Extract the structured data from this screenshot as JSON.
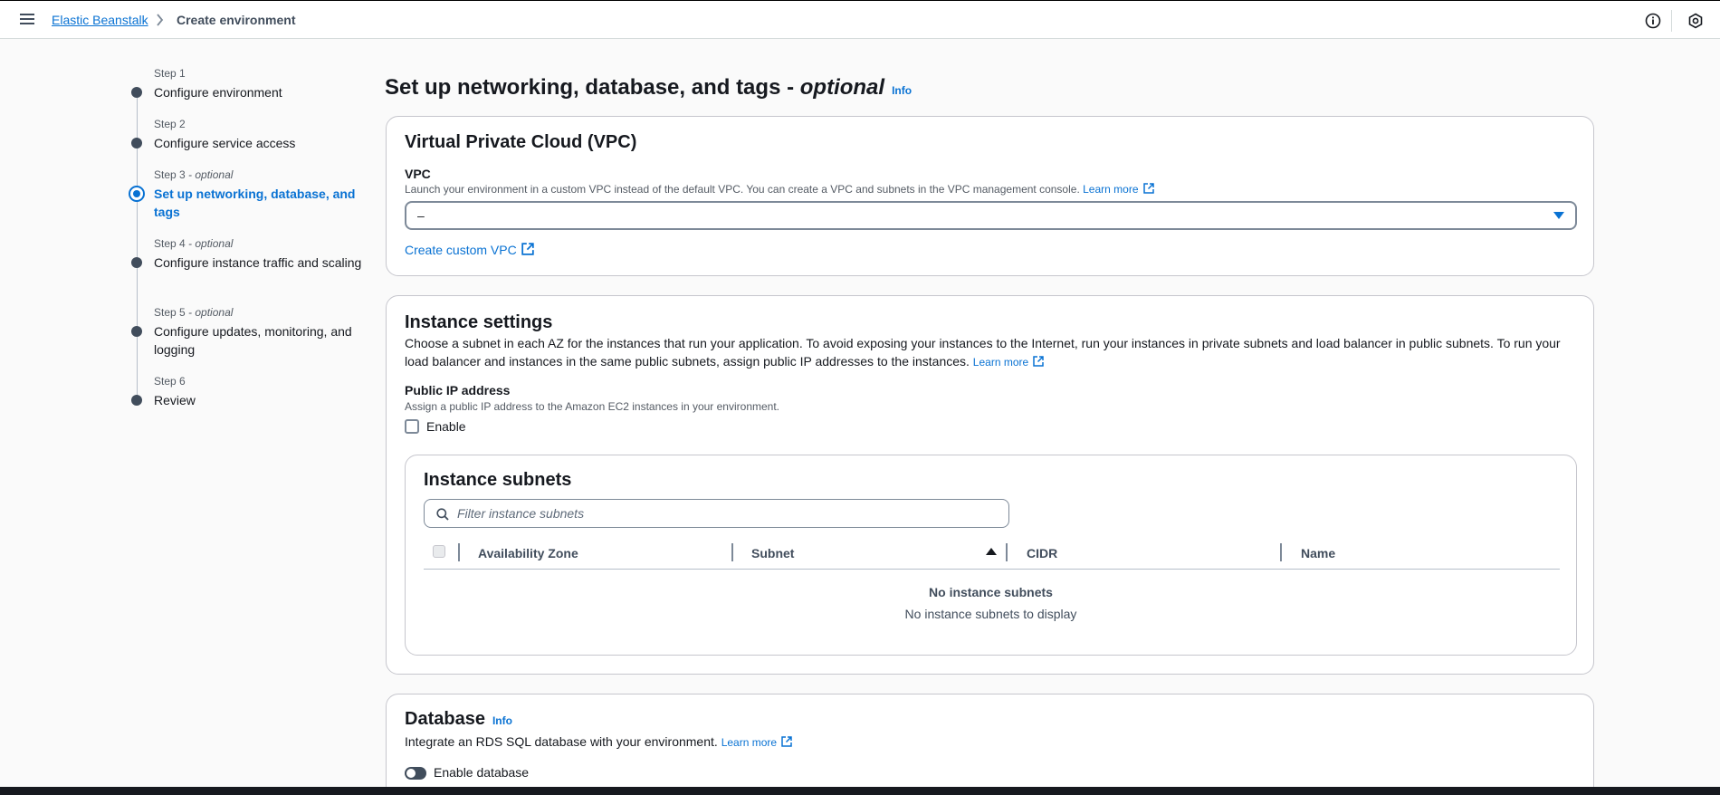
{
  "topbar": {
    "breadcrumb_link": "Elastic Beanstalk",
    "breadcrumb_current": "Create environment"
  },
  "steps": [
    {
      "num": "Step 1",
      "optional": "",
      "label": "Configure environment"
    },
    {
      "num": "Step 2",
      "optional": "",
      "label": "Configure service access"
    },
    {
      "num": "Step 3",
      "optional": " - optional",
      "label": "Set up networking, database, and tags"
    },
    {
      "num": "Step 4",
      "optional": " - optional",
      "label": "Configure instance traffic and scaling"
    },
    {
      "num": "Step 5",
      "optional": " - optional",
      "label": "Configure updates, monitoring, and logging"
    },
    {
      "num": "Step 6",
      "optional": "",
      "label": "Review"
    }
  ],
  "page": {
    "title": "Set up networking, database, and tags - ",
    "title_optional": "optional",
    "info": "Info"
  },
  "vpc": {
    "title": "Virtual Private Cloud (VPC)",
    "label": "VPC",
    "description": "Launch your environment in a custom VPC instead of the default VPC. You can create a VPC and subnets in the VPC management console.",
    "learn_more": "Learn more",
    "selected": "–",
    "create_link": "Create custom VPC"
  },
  "instance": {
    "title": "Instance settings",
    "description": "Choose a subnet in each AZ for the instances that run your application. To avoid exposing your instances to the Internet, run your instances in private subnets and load balancer in public subnets. To run your load balancer and instances in the same public subnets, assign public IP addresses to the instances.",
    "learn_more": "Learn more",
    "public_ip_label": "Public IP address",
    "public_ip_desc": "Assign a public IP address to the Amazon EC2 instances in your environment.",
    "enable_label": "Enable",
    "subnets": {
      "title": "Instance subnets",
      "search_placeholder": "Filter instance subnets",
      "columns": [
        "Availability Zone",
        "Subnet",
        "CIDR",
        "Name"
      ],
      "empty_title": "No instance subnets",
      "empty_sub": "No instance subnets to display"
    }
  },
  "database": {
    "title": "Database",
    "info": "Info",
    "description": "Integrate an RDS SQL database with your environment.",
    "learn_more": "Learn more",
    "toggle_label": "Enable database"
  },
  "colors": {
    "accent": "#0972d3",
    "text": "#16191f",
    "border": "#c6c6cd"
  }
}
